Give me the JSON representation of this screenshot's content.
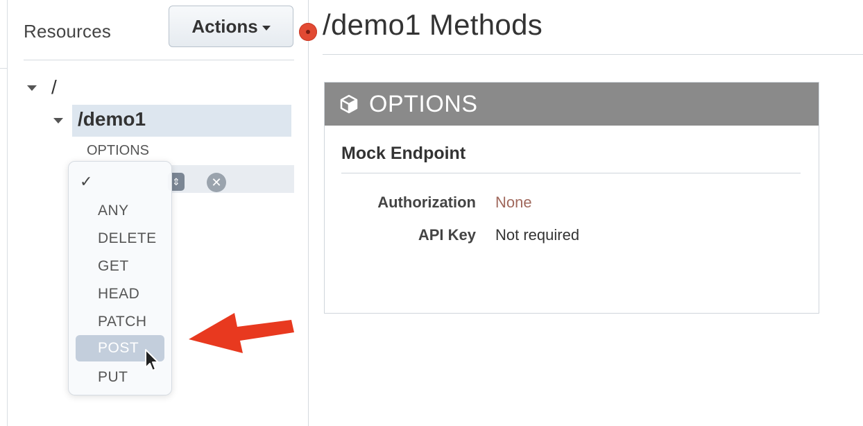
{
  "sidebar": {
    "title": "Resources",
    "actions_label": "Actions",
    "tree": {
      "root_label": "/",
      "resource_label": "/demo1",
      "method_label": "OPTIONS",
      "new_method_checkmark": "✓"
    },
    "method_dropdown": {
      "options": [
        "ANY",
        "DELETE",
        "GET",
        "HEAD",
        "PATCH",
        "POST",
        "PUT"
      ],
      "highlighted": "POST"
    }
  },
  "main": {
    "title": "/demo1 Methods",
    "card": {
      "header_icon": "cube-icon",
      "header_title": "OPTIONS",
      "subtitle": "Mock Endpoint",
      "rows": [
        {
          "label": "Authorization",
          "value": "None",
          "color": "#a0685c"
        },
        {
          "label": "API Key",
          "value": "Not required",
          "color": "#333333"
        }
      ]
    }
  },
  "colors": {
    "header_bg": "#8a8a8a",
    "selected_row": "#dde6ef",
    "highlighted_option": "#c3cedc",
    "annotation_arrow": "#e8391f"
  },
  "icons": [
    "cube-icon",
    "chevron-down-icon",
    "check-icon",
    "select-arrows-icon",
    "cancel-icon",
    "cursor-icon",
    "annotation-arrow-icon"
  ]
}
